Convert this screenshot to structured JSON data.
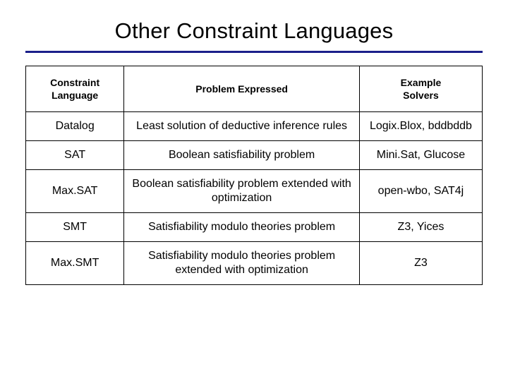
{
  "slide": {
    "title": "Other Constraint Languages",
    "accent_color": "#1b1f8a",
    "border_color": "#000000"
  },
  "table": {
    "headers": [
      "Constraint\nLanguage",
      "Problem Expressed",
      "Example\nSolvers"
    ],
    "headers_lines": [
      [
        "Constraint",
        "Language"
      ],
      [
        "Problem Expressed"
      ],
      [
        "Example",
        "Solvers"
      ]
    ],
    "rows": [
      {
        "language": "Datalog",
        "problem": "Least solution of deductive inference rules",
        "solvers": "Logix.Blox, bddbddb"
      },
      {
        "language": "SAT",
        "problem": "Boolean satisfiability problem",
        "solvers": "Mini.Sat, Glucose"
      },
      {
        "language": "Max.SAT",
        "problem": "Boolean satisfiability problem extended with optimization",
        "solvers": "open-wbo, SAT4j"
      },
      {
        "language": "SMT",
        "problem": "Satisfiability modulo theories problem",
        "solvers": "Z3, Yices"
      },
      {
        "language": "Max.SMT",
        "problem": "Satisfiability modulo theories problem extended with optimization",
        "solvers": "Z3"
      }
    ]
  }
}
